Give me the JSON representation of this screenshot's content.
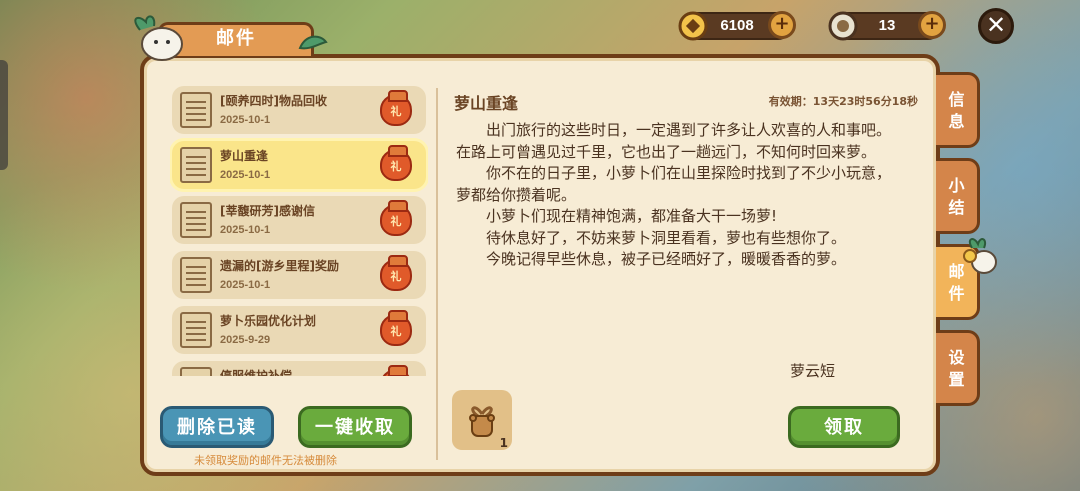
{
  "title_tab": {
    "label": "邮件"
  },
  "currency": {
    "coin": {
      "value": "6108",
      "icon": "coin-icon"
    },
    "gem": {
      "value": "13",
      "icon": "gem-icon"
    }
  },
  "mail_list": {
    "items": [
      {
        "title": "[颐养四时]物品回收",
        "date": "2025-10-1",
        "reward": "礼"
      },
      {
        "title": "萝山重逢",
        "date": "2025-10-1",
        "reward": "礼"
      },
      {
        "title": "[莘馥研芳]感谢信",
        "date": "2025-10-1",
        "reward": "礼"
      },
      {
        "title": "遗漏的[游乡里程]奖励",
        "date": "2025-10-1",
        "reward": "礼"
      },
      {
        "title": "萝卜乐园优化计划",
        "date": "2025-9-29",
        "reward": "礼"
      },
      {
        "title": "停服维护补偿",
        "date": "",
        "reward": "礼"
      }
    ]
  },
  "buttons": {
    "delete_read": "删除已读",
    "collect_all": "一键收取",
    "claim": "领取"
  },
  "note": "未领取奖励的邮件无法被删除",
  "mail": {
    "heading": "萝山重逢",
    "validity": "有效期：13天23时56分18秒",
    "paragraphs": [
      "出门旅行的这些时日，一定遇到了许多让人欢喜的人和事吧。在路上可曾遇见过千里，它也出了一趟远门，不知何时回来萝。",
      "你不在的日子里，小萝卜们在山里探险时找到了不少小玩意，萝都给你攒着呢。",
      "小萝卜们现在精神饱满，都准备大干一场萝!",
      "待休息好了，不妨来萝卜洞里看看，萝也有些想你了。",
      "今晚记得早些休息，被子已经晒好了，暖暖香香的萝。"
    ],
    "signature": "萝云短",
    "reward": {
      "count": "1",
      "icon": "bear-reward-icon"
    }
  },
  "side_tabs": {
    "info": "信息",
    "summary": "小结",
    "mail": "邮件",
    "settings": "设置"
  },
  "colors": {
    "panel_bg": "#f7ecd5",
    "border": "#6e3d18",
    "tab_active": "#f2b45a",
    "btn_blue": "#4a95b5",
    "btn_green": "#6aab3d"
  }
}
